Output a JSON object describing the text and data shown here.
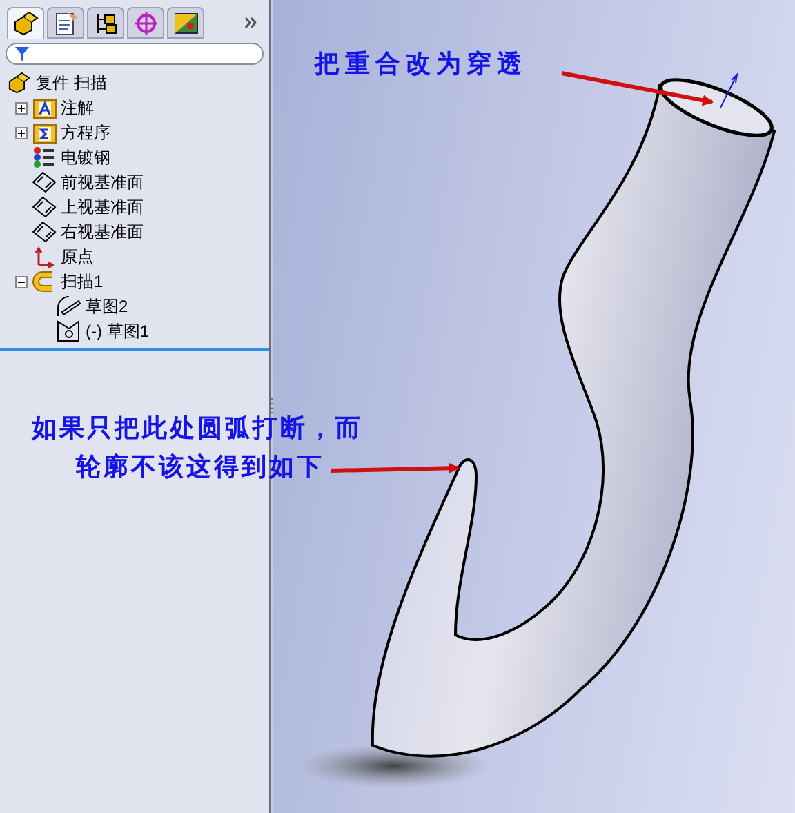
{
  "panel": {
    "tabs": [
      {
        "kind": "feature",
        "selected": true
      },
      {
        "kind": "property",
        "selected": false
      },
      {
        "kind": "config",
        "selected": false
      },
      {
        "kind": "dim",
        "selected": false
      },
      {
        "kind": "display",
        "selected": false
      }
    ],
    "tree": {
      "label": "复件 扫描",
      "kind": "part",
      "children": [
        {
          "label": "注解",
          "kind": "annotation",
          "expanded": false
        },
        {
          "label": "方程序",
          "kind": "equation",
          "expanded": false
        },
        {
          "label": "电镀钢",
          "kind": "material"
        },
        {
          "label": "前视基准面",
          "kind": "plane"
        },
        {
          "label": "上视基准面",
          "kind": "plane"
        },
        {
          "label": "右视基准面",
          "kind": "plane"
        },
        {
          "label": "原点",
          "kind": "origin"
        },
        {
          "label": "扫描1",
          "kind": "sweep",
          "expanded": true,
          "children": [
            {
              "label": "草图2",
              "kind": "sketch"
            },
            {
              "label": "(-) 草图1",
              "kind": "sketch2"
            }
          ]
        }
      ]
    }
  },
  "annotations": [
    {
      "lines": [
        "把重合改为穿透"
      ]
    },
    {
      "lines": [
        "如果只把此处圆弧打断，而",
        "轮廓不该这得到如下"
      ]
    }
  ]
}
